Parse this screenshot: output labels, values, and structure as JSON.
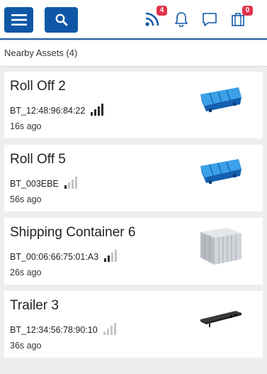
{
  "header": {
    "menu_icon": "hamburger-icon",
    "search_icon": "search-icon",
    "feed_icon": "rss-icon",
    "feed_badge": "4",
    "bell_icon": "bell-icon",
    "chat_icon": "chat-icon",
    "inventory_icon": "luggage-icon",
    "inventory_badge": "0",
    "brand_color": "#0f57a6",
    "badge_color": "#e0324b"
  },
  "section": {
    "title": "Nearby Assets (4)"
  },
  "assets": [
    {
      "name": "Roll Off 2",
      "device_id": "BT_12:48:96:84:22",
      "signal_bars": 4,
      "time": "16s ago",
      "image": "blue-roll-off-container"
    },
    {
      "name": "Roll Off 5",
      "device_id": "BT_003EBE",
      "signal_bars": 1,
      "time": "56s ago",
      "image": "blue-roll-off-container"
    },
    {
      "name": "Shipping Container 6",
      "device_id": "BT_00:06:66:75:01:A3",
      "signal_bars": 2,
      "time": "26s ago",
      "image": "grey-shipping-container"
    },
    {
      "name": "Trailer 3",
      "device_id": "BT_12:34:56:78:90:10",
      "signal_bars": 0,
      "time": "36s ago",
      "image": "flatbed-trailer"
    }
  ]
}
